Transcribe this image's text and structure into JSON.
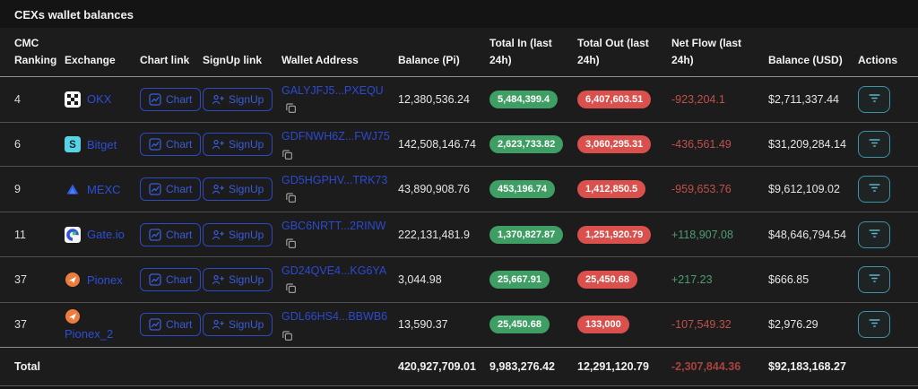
{
  "title": "CEXs wallet balances",
  "colors": {
    "link_blue": "#2d4cd3",
    "positive_pill": "#3f9e63",
    "negative_pill": "#d9504c",
    "positive_text": "#4e9d72",
    "negative_text": "#c0504a",
    "action_teal": "#3e92a8"
  },
  "table": {
    "headers": [
      "CMC Ranking",
      "Exchange",
      "Chart link",
      "SignUp link",
      "Wallet Address",
      "Balance (Pi)",
      "Total In (last 24h)",
      "Total Out (last 24h)",
      "Net Flow (last 24h)",
      "Balance (USD)",
      "Actions"
    ],
    "chart_button_label": "Chart",
    "signup_button_label": "SignUp",
    "rows": [
      {
        "rank": "4",
        "exchange": "OKX",
        "icon": "okx-logo",
        "wallet": "GALYJFJ5...PXEQU",
        "balance_pi": "12,380,536.24",
        "total_in": "5,484,399.4",
        "total_out": "6,407,603.51",
        "net_flow": "-923,204.1",
        "balance_usd": "$2,711,337.44"
      },
      {
        "rank": "6",
        "exchange": "Bitget",
        "icon": "bitget-logo",
        "wallet": "GDFNWH6Z...FWJ75",
        "balance_pi": "142,508,146.74",
        "total_in": "2,623,733.82",
        "total_out": "3,060,295.31",
        "net_flow": "-436,561.49",
        "balance_usd": "$31,209,284.14"
      },
      {
        "rank": "9",
        "exchange": "MEXC",
        "icon": "mexc-logo",
        "wallet": "GD5HGPHV...TRK73",
        "balance_pi": "43,890,908.76",
        "total_in": "453,196.74",
        "total_out": "1,412,850.5",
        "net_flow": "-959,653.76",
        "balance_usd": "$9,612,109.02"
      },
      {
        "rank": "11",
        "exchange": "Gate.io",
        "icon": "gateio-logo",
        "wallet": "GBC6NRTT...2RINW",
        "balance_pi": "222,131,481.9",
        "total_in": "1,370,827.87",
        "total_out": "1,251,920.79",
        "net_flow": "+118,907.08",
        "balance_usd": "$48,646,794.54"
      },
      {
        "rank": "37",
        "exchange": "Pionex",
        "icon": "pionex-logo",
        "wallet": "GD24QVE4...KG6YA",
        "balance_pi": "3,044.98",
        "total_in": "25,667.91",
        "total_out": "25,450.68",
        "net_flow": "+217.23",
        "balance_usd": "$666.85"
      },
      {
        "rank": "37",
        "exchange": "Pionex_2",
        "icon": "pionex-logo",
        "wallet": "GDL66HS4...BBWB6",
        "balance_pi": "13,590.37",
        "total_in": "25,450.68",
        "total_out": "133,000",
        "net_flow": "-107,549.32",
        "balance_usd": "$2,976.29"
      }
    ],
    "total": {
      "label": "Total",
      "balance_pi": "420,927,709.01",
      "total_in": "9,983,276.42",
      "total_out": "12,291,120.79",
      "net_flow": "-2,307,844.36",
      "balance_usd": "$92,183,168.27"
    }
  }
}
